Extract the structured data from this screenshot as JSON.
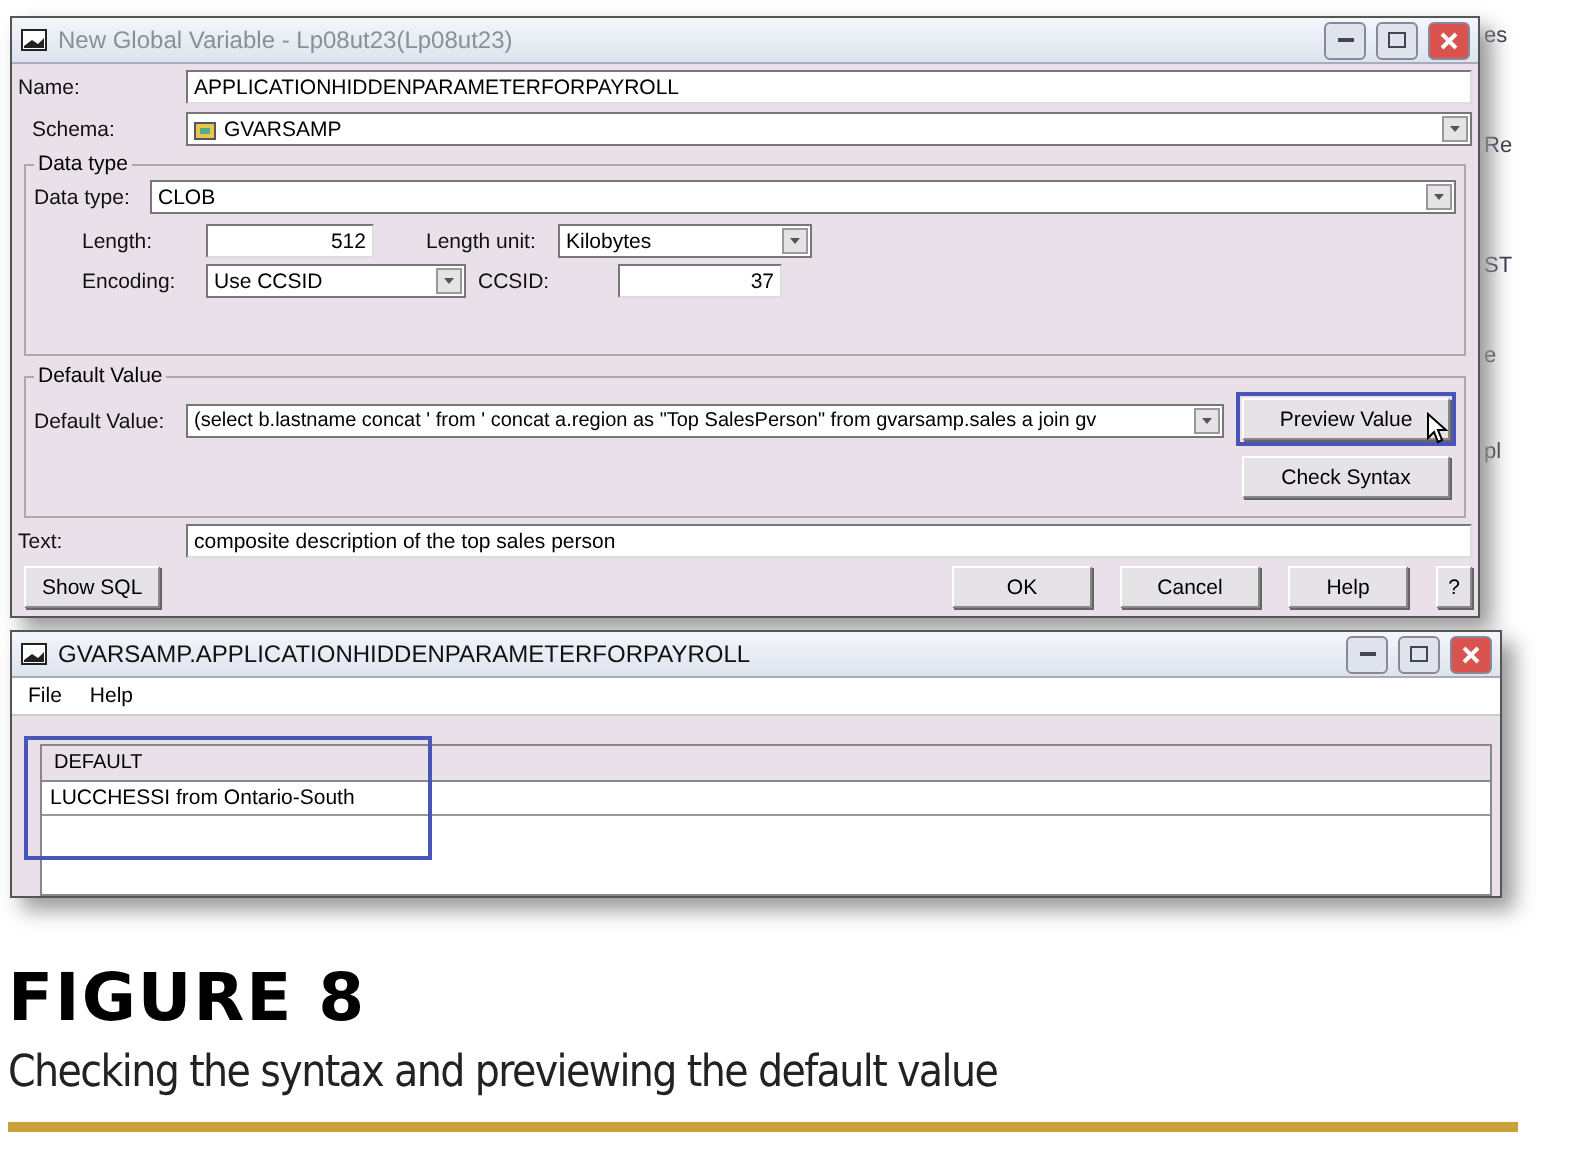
{
  "dialog": {
    "title": "New Global Variable - Lp08ut23(Lp08ut23)",
    "name": {
      "label": "Name:",
      "value": "APPLICATIONHIDDENPARAMETERFORPAYROLL"
    },
    "schema": {
      "label": "Schema:",
      "value": "GVARSAMP"
    },
    "data_type_group": {
      "title": "Data type",
      "data_type": {
        "label": "Data type:",
        "value": "CLOB"
      },
      "length": {
        "label": "Length:",
        "value": "512"
      },
      "length_unit": {
        "label": "Length unit:",
        "value": "Kilobytes"
      },
      "encoding": {
        "label": "Encoding:",
        "value": "Use CCSID"
      },
      "ccsid": {
        "label": "CCSID:",
        "value": "37"
      }
    },
    "default_group": {
      "title": "Default Value",
      "default_value": {
        "label": "Default Value:",
        "value": "(select b.lastname concat ' from ' concat a.region as \"Top SalesPerson\" from gvarsamp.sales a join gv"
      },
      "buttons": [
        {
          "label": "Preview Value",
          "highlighted": true
        },
        {
          "label": "Check Syntax",
          "highlighted": false
        }
      ]
    },
    "text": {
      "label": "Text:",
      "value": "composite description of the top sales person"
    },
    "show_sql": "Show SQL",
    "buttons": [
      "OK",
      "Cancel",
      "Help",
      "?"
    ]
  },
  "background_window": {
    "fragments": [
      "es",
      "Re",
      "ST",
      "e",
      "pl"
    ]
  },
  "results": {
    "title": "GVARSAMP.APPLICATIONHIDDENPARAMETERFORPAYROLL",
    "menu": [
      "File",
      "Help"
    ],
    "column": "DEFAULT",
    "rows": [
      "LUCCHESSI from Ontario-South"
    ],
    "highlighted": true
  },
  "caption": {
    "heading": "FIGURE 8",
    "text": "Checking the syntax and previewing the default value"
  }
}
